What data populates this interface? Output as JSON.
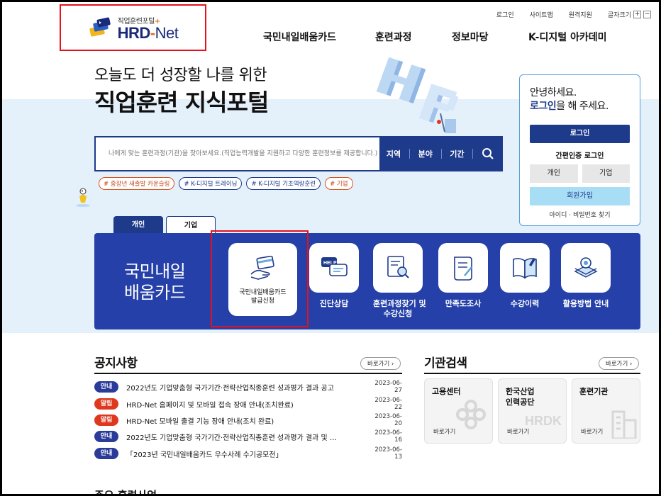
{
  "header": {
    "logo_sub": "직업훈련포털",
    "logo_main": "HRD",
    "logo_dash": "-",
    "logo_net": "Net",
    "util": [
      "로그인",
      "사이트맵",
      "원격지원",
      "글자크기"
    ],
    "font_plus": "+",
    "font_minus": "−",
    "gnb": [
      "국민내일배움카드",
      "훈련과정",
      "정보마당",
      "K-디지털 아카데미"
    ]
  },
  "hero": {
    "subtitle": "오늘도 더 성장할 나를 위한",
    "title": "직업훈련 지식포털"
  },
  "search": {
    "placeholder": "나에게 맞는 훈련과정(기관)을 찾아보세요.(직업능력개발을 지원하고 다양한 훈련정보를 제공합니다.)",
    "filters": [
      "지역",
      "분야",
      "기간"
    ]
  },
  "tags": [
    "# 중장년 새출발 카운슬링",
    "# K-디지털 트레이닝",
    "# K-디지털 기초역량훈련",
    "# 기업"
  ],
  "login": {
    "hello": "안녕하세요.",
    "login_word": "로그인",
    "hello_suffix": "을 해 주세요.",
    "login_button": "로그인",
    "easy_login": "간편인증 로그인",
    "personal": "개인",
    "company": "기업",
    "join": "회원가입",
    "find": "아이디 · 비밀번호 찾기"
  },
  "tabs": [
    "개인",
    "기업"
  ],
  "panel": {
    "title_line1": "국민내일",
    "title_line2": "배움카드",
    "main_card_line1": "국민내일배움카드",
    "main_card_line2": "발급신청",
    "services": [
      {
        "label": "진단상담",
        "icon": "help-chat-icon"
      },
      {
        "label": "훈련과정찾기 및",
        "label2": "수강신청",
        "icon": "search-document-icon"
      },
      {
        "label": "만족도조사",
        "icon": "survey-icon"
      },
      {
        "label": "수강이력",
        "icon": "book-icon"
      },
      {
        "label": "활용방법 안내",
        "icon": "guide-icon"
      }
    ]
  },
  "notices": {
    "title": "공지사항",
    "more": "바로가기",
    "items": [
      {
        "badge": "안내",
        "type": "info",
        "title": "2022년도 기업맞춤형 국가기간·전략산업직종훈련 성과평가 결과 공고",
        "date": "2023-06-27"
      },
      {
        "badge": "알림",
        "type": "alert",
        "title": "HRD-Net 홈페이지 및 모바일 접속 장애 안내(조치완료)",
        "date": "2023-06-22"
      },
      {
        "badge": "알림",
        "type": "alert",
        "title": "HRD-Net 모바일 출결 기능 장애 안내(조치 완료)",
        "date": "2023-06-20"
      },
      {
        "badge": "안내",
        "type": "info",
        "title": "2022년도 기업맞춤형 국가기간·전략산업직종훈련 성과평가 결과 및 …",
        "date": "2023-06-16"
      },
      {
        "badge": "안내",
        "type": "info",
        "title": "「2023년 국민내일배움카드 우수사례 수기공모전」",
        "date": "2023-06-13"
      }
    ]
  },
  "institutions": {
    "title": "기관검색",
    "more": "바로가기",
    "items": [
      {
        "line1": "고용센터",
        "line2": "",
        "go": "바로가기"
      },
      {
        "line1": "한국산업",
        "line2": "인력공단",
        "go": "바로가기"
      },
      {
        "line1": "훈련기관",
        "line2": "",
        "go": "바로가기"
      }
    ],
    "watermark": "HRDK"
  },
  "bottom": {
    "title": "주요 훈련사업"
  }
}
